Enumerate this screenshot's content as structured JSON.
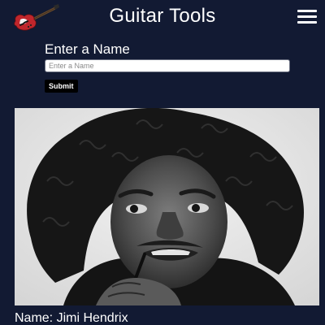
{
  "header": {
    "title": "Guitar Tools"
  },
  "form": {
    "label": "Enter a Name",
    "input_value": "",
    "input_placeholder": "Enter a Name",
    "submit_label": "Submit"
  },
  "result": {
    "caption": "Name: Jimi Hendrix"
  },
  "icons": {
    "logo": "red-electric-guitar-icon",
    "menu": "hamburger-menu-icon"
  },
  "colors": {
    "background": "#121a33",
    "text": "#ffffff",
    "button": "#000000",
    "logo_body": "#c0262c"
  }
}
